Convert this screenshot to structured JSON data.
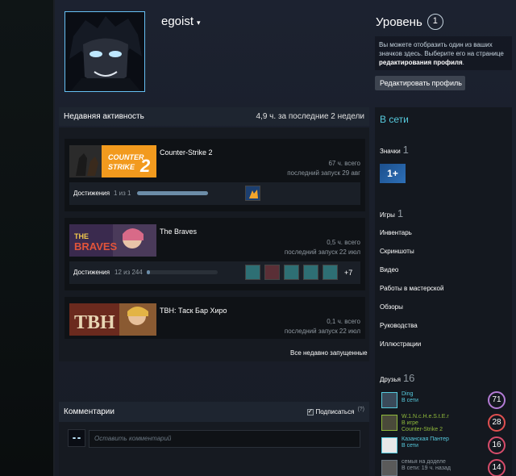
{
  "profile": {
    "persona_name": "egoist",
    "caret": "▾"
  },
  "level": {
    "title": "Уровень",
    "value": "1",
    "desc_1": "Вы можете отобразить один из ваших значков здесь. Выберите его на странице ",
    "desc_link": "редактирования профиля",
    "desc_end": ".",
    "edit_button": "Редактировать профиль"
  },
  "activity": {
    "title": "Недавняя активность",
    "hours": "4,9 ч. за последние 2 недели",
    "games": [
      {
        "name": "Counter-Strike 2",
        "hours": "67 ч. всего",
        "last": "последний запуск 29 авг",
        "ach_label": "Достижения",
        "ach_count": "1 из 1",
        "progress": 1.0
      },
      {
        "name": "The Braves",
        "hours": "0,5 ч. всего",
        "last": "последний запуск 22 июл",
        "ach_label": "Достижения",
        "ach_count": "12 из 244",
        "progress": 0.05,
        "more": "+7"
      },
      {
        "name": "TBH: Таск Бар Хиро",
        "hours": "0,1 ч. всего",
        "last": "последний запуск 22 июл"
      }
    ],
    "all_recent": "Все недавно запущенные"
  },
  "comments": {
    "title": "Комментарии",
    "subscribe": "Подписаться",
    "help": "(?)",
    "placeholder": "Оставить комментарий"
  },
  "sidebar": {
    "online": "В сети",
    "badges_label": "Значки",
    "badges_count": "1",
    "badge_text": "1+",
    "games_label": "Игры",
    "games_count": "1",
    "inventory": "Инвентарь",
    "screenshots": "Скриншоты",
    "video": "Видео",
    "workshop": "Работы в мастерской",
    "reviews": "Обзоры",
    "guides": "Руководства",
    "artwork": "Иллюстрации",
    "friends_label": "Друзья",
    "friends_count": "16"
  },
  "friends": [
    {
      "name": "Ding",
      "status": "В сети",
      "game": "",
      "level": "71",
      "color": "#b47cd6",
      "name_color": "#57cbde"
    },
    {
      "name": "W.1.N.c.H.e.S.t.E.r",
      "status": "В игре",
      "game": "Counter-Strike 2",
      "level": "28",
      "color": "#e05050",
      "name_color": "#8fb93b"
    },
    {
      "name": "Казанская Пантер",
      "status": "В сети",
      "game": "",
      "level": "16",
      "color": "#d64c6a",
      "name_color": "#57cbde"
    },
    {
      "name": "семья на доделе",
      "status": "В сети: 19 ч. назад",
      "game": "",
      "level": "14",
      "color": "#d64c6a",
      "name_color": "#8f98a0"
    }
  ],
  "colors": {
    "accent": "#57cbde",
    "in_game": "#8fb93b",
    "avatar_border": "#66c0f4"
  }
}
